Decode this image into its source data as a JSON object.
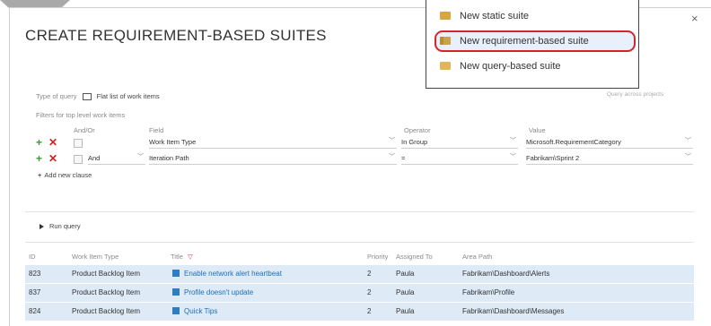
{
  "dialog": {
    "title": "CREATE REQUIREMENT-BASED SUITES",
    "close_icon": "×"
  },
  "query": {
    "type_label": "Type of query",
    "type_value": "Flat list of work items",
    "filters_label": "Filters for top level work items",
    "query_across_label": "Query across projects",
    "headers": {
      "and_or": "And/Or",
      "field": "Field",
      "operator": "Operator",
      "value": "Value"
    },
    "clauses": [
      {
        "and_or": "",
        "field": "Work Item Type",
        "operator": "In Group",
        "value": "Microsoft.RequirementCategory"
      },
      {
        "and_or": "And",
        "field": "Iteration Path",
        "operator": "=",
        "value": "Fabrikam\\Sprint 2"
      }
    ],
    "add_clause": "Add new clause",
    "run_query": "Run query"
  },
  "results": {
    "headers": {
      "id": "ID",
      "type": "Work Item Type",
      "title": "Title",
      "priority": "Priority",
      "assigned": "Assigned To",
      "area": "Area Path"
    },
    "rows": [
      {
        "id": "823",
        "type": "Product Backlog Item",
        "title": "Enable network alert heartbeat",
        "priority": "2",
        "assigned": "Paula",
        "area": "Fabrikam\\Dashboard\\Alerts"
      },
      {
        "id": "837",
        "type": "Product Backlog Item",
        "title": "Profile doesn't update",
        "priority": "2",
        "assigned": "Paula",
        "area": "Fabrikam\\Profile"
      },
      {
        "id": "824",
        "type": "Product Backlog Item",
        "title": "Quick Tips",
        "priority": "2",
        "assigned": "Paula",
        "area": "Fabrikam\\Dashboard\\Messages"
      }
    ]
  },
  "menu": {
    "items": [
      {
        "label": "New static suite",
        "icon": "folder-icon"
      },
      {
        "label": "New requirement-based suite",
        "icon": "requirement-folder-icon"
      },
      {
        "label": "New query-based suite",
        "icon": "query-folder-icon"
      }
    ]
  },
  "colors": {
    "highlight_border": "#d0262c",
    "link": "#1e6fb8",
    "selected_row": "#deeaf6",
    "add": "#3a9a3a",
    "remove": "#cc2222"
  }
}
